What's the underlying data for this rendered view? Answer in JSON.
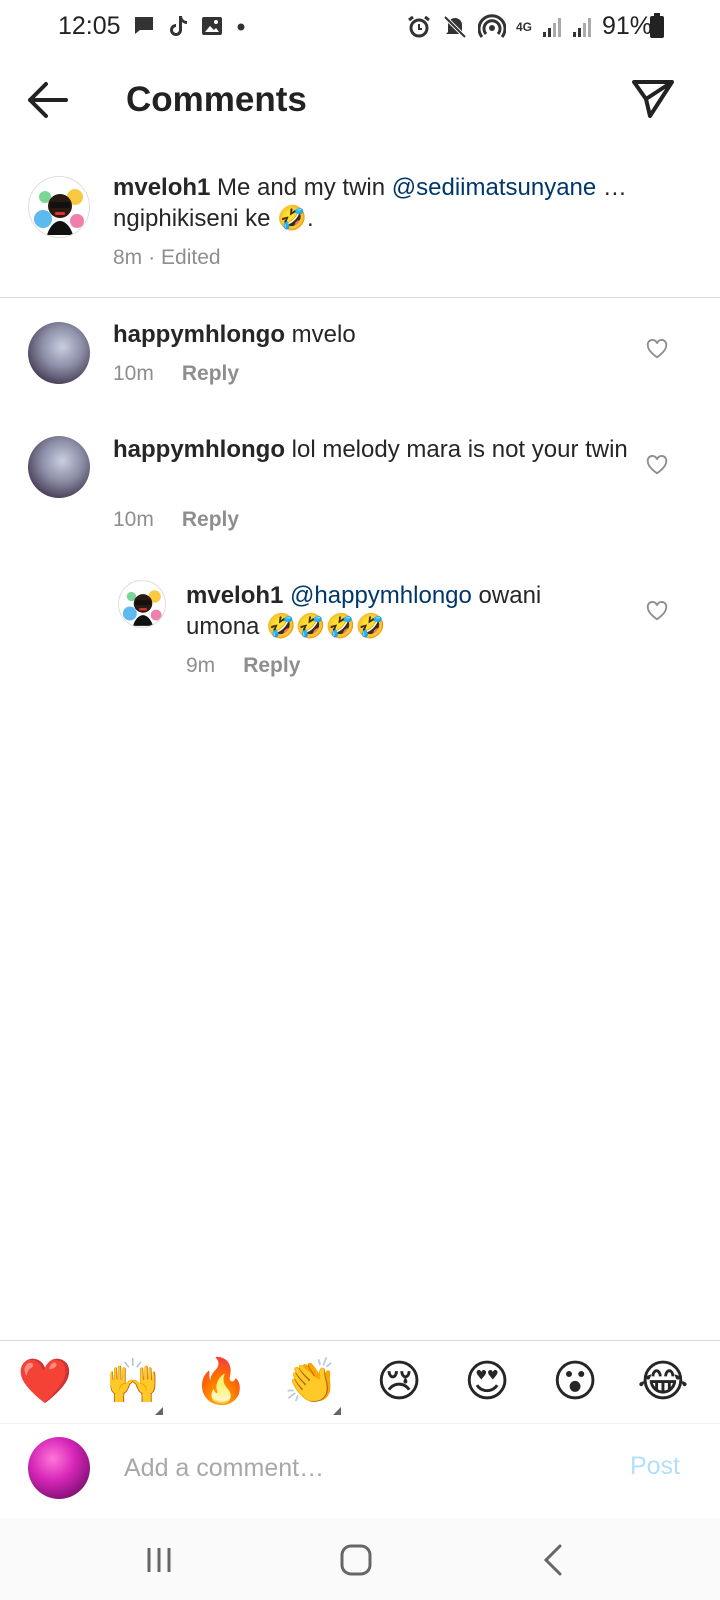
{
  "status_bar": {
    "time": "12:05",
    "battery": "91%",
    "network": "4G",
    "left_icons": [
      "message-icon",
      "tiktok-icon",
      "gallery-icon",
      "dot-icon"
    ],
    "right_icons": [
      "alarm-icon",
      "mute-icon",
      "hotspot-icon",
      "network-4g-icon",
      "signal-icon",
      "signal-icon",
      "battery-icon"
    ]
  },
  "header": {
    "title": "Comments",
    "back_icon": "arrow-left-icon",
    "send_icon": "paper-plane-icon"
  },
  "caption": {
    "username": "mveloh1",
    "text_before": " Me and my twin ",
    "mention": "@sediimatsunyane",
    "text_after": " … ngiphikiseni ke 🤣.",
    "time": "8m",
    "edited": "· Edited"
  },
  "comments": [
    {
      "username": "happymhlongo",
      "text": " mvelo",
      "time": "10m",
      "reply": "Reply"
    },
    {
      "username": "happymhlongo",
      "text": " lol  melody mara is not your twin",
      "time": "10m",
      "reply": "Reply"
    },
    {
      "username": "mveloh1",
      "mention": "@happymhlongo",
      "text": " owani umona 🤣🤣🤣🤣",
      "time": "9m",
      "reply": "Reply"
    }
  ],
  "emoji_bar": [
    "❤️",
    "🙌",
    "🔥",
    "👏",
    "😢",
    "😍",
    "😮",
    "😂"
  ],
  "composer": {
    "placeholder": "Add a comment…",
    "post": "Post"
  },
  "colors": {
    "mention": "#00376b",
    "meta": "#8e8e8e",
    "post_disabled": "#b2dffc",
    "divider": "#dbdbdb"
  }
}
